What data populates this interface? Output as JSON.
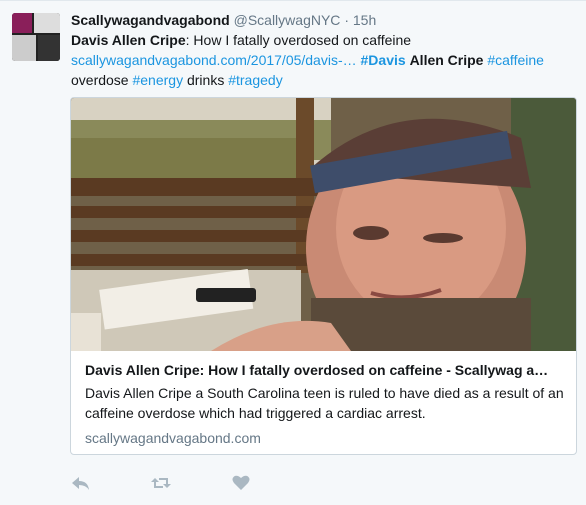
{
  "tweet": {
    "author_name": "Scallywagandvagabond",
    "author_handle": "@ScallywagNYC",
    "separator": "·",
    "timestamp": "15h",
    "text_bold": "Davis Allen Cripe",
    "text_plain_1": ": How I fatally overdosed on caffeine",
    "text_link": "scallywagandvagabond.com/2017/05/davis-…",
    "hashtag_davis": "#Davis",
    "text_bold_2": "Allen Cripe",
    "hashtag_caffeine": "#caffeine",
    "text_plain_2": "overdose",
    "hashtag_energy": "#energy",
    "text_plain_3": "drinks",
    "hashtag_tragedy": "#tragedy"
  },
  "card": {
    "title": "Davis Allen Cripe: How I fatally overdosed on caffeine - Scallywag a…",
    "description": "Davis Allen Cripe a South Carolina teen is ruled to have died as a result of an caffeine overdose which had triggered a cardiac arrest.",
    "domain": "scallywagandvagabond.com"
  },
  "actions": {
    "reply_icon": "reply-icon",
    "retweet_icon": "retweet-icon",
    "like_icon": "heart-icon"
  },
  "colors": {
    "link": "#1b95e0",
    "muted": "#657786",
    "icon": "#aab8c2"
  }
}
